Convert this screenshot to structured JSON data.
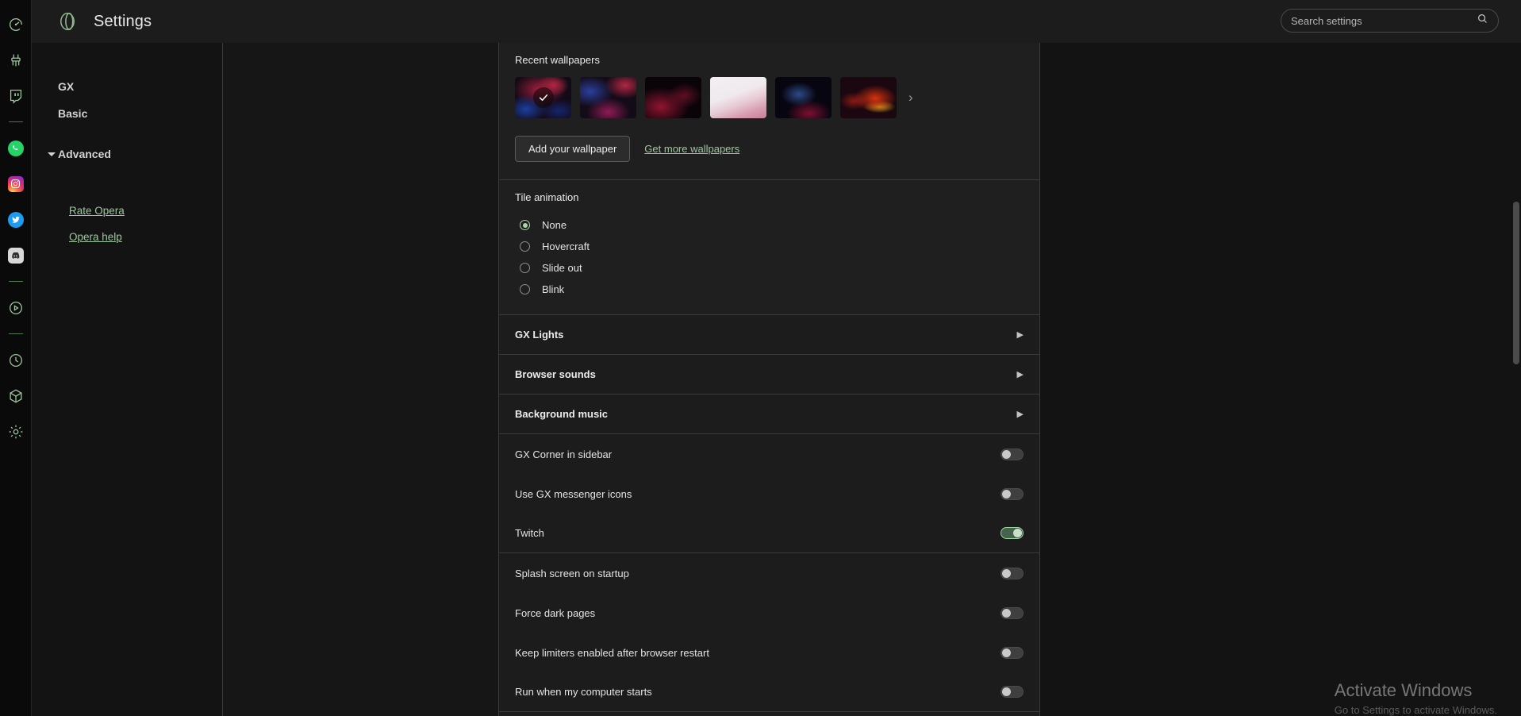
{
  "header": {
    "title": "Settings",
    "logo_icon": "opera-logo-icon",
    "search": {
      "placeholder": "Search settings",
      "value": "",
      "icon": "search-icon"
    }
  },
  "rail": {
    "items": [
      {
        "name": "speed-dial-icon",
        "kind": "outline"
      },
      {
        "name": "cleaner-broom-icon",
        "kind": "outline"
      },
      {
        "name": "twitch-icon",
        "kind": "outline"
      },
      {
        "name": "separator",
        "kind": "sep"
      },
      {
        "name": "whatsapp-icon",
        "kind": "color"
      },
      {
        "name": "instagram-icon",
        "kind": "color"
      },
      {
        "name": "twitter-icon",
        "kind": "color"
      },
      {
        "name": "discord-icon",
        "kind": "color"
      },
      {
        "name": "separator",
        "kind": "sep"
      },
      {
        "name": "player-icon",
        "kind": "outline"
      },
      {
        "name": "separator",
        "kind": "sep"
      },
      {
        "name": "history-clock-icon",
        "kind": "outline"
      },
      {
        "name": "extensions-cube-icon",
        "kind": "outline"
      },
      {
        "name": "settings-gear-icon",
        "kind": "outline"
      }
    ]
  },
  "nav": {
    "items": [
      {
        "label": "GX"
      },
      {
        "label": "Basic"
      },
      {
        "label": "Advanced"
      }
    ],
    "help_links": [
      {
        "label": "Rate Opera"
      },
      {
        "label": "Opera help"
      }
    ]
  },
  "wallpapers": {
    "title": "Recent wallpapers",
    "thumbs": [
      {
        "name": "wallpaper-thumb-1",
        "selected": true
      },
      {
        "name": "wallpaper-thumb-2",
        "selected": false
      },
      {
        "name": "wallpaper-thumb-3",
        "selected": false
      },
      {
        "name": "wallpaper-thumb-4",
        "selected": false
      },
      {
        "name": "wallpaper-thumb-5",
        "selected": false
      },
      {
        "name": "wallpaper-thumb-6",
        "selected": false
      }
    ],
    "next_arrow": "›",
    "add_button": "Add your wallpaper",
    "get_more_link": "Get more wallpapers"
  },
  "tile_animation": {
    "title": "Tile animation",
    "selected": "None",
    "options": [
      {
        "label": "None",
        "checked": true
      },
      {
        "label": "Hovercraft",
        "checked": false
      },
      {
        "label": "Slide out",
        "checked": false
      },
      {
        "label": "Blink",
        "checked": false
      }
    ]
  },
  "expandables": [
    {
      "label": "GX Lights",
      "chevron": "▶"
    },
    {
      "label": "Browser sounds",
      "chevron": "▶"
    },
    {
      "label": "Background music",
      "chevron": "▶"
    }
  ],
  "toggle_groups": [
    {
      "rows": [
        {
          "label": "GX Corner in sidebar",
          "on": false
        },
        {
          "label": "Use GX messenger icons",
          "on": false
        },
        {
          "label": "Twitch",
          "on": true
        }
      ]
    },
    {
      "rows": [
        {
          "label": "Splash screen on startup",
          "on": false
        },
        {
          "label": "Force dark pages",
          "on": false
        },
        {
          "label": "Keep limiters enabled after browser restart",
          "on": false
        },
        {
          "label": "Run when my computer starts",
          "on": false
        }
      ]
    }
  ],
  "watermark": {
    "title": "Activate Windows",
    "subtitle": "Go to Settings to activate Windows."
  },
  "colors": {
    "accent_green": "#9ec79e",
    "panel": "#1c1c1c",
    "card": "#1f1f1f",
    "background": "#131313",
    "rail": "#0a0a0a",
    "text": "#e4e4e4",
    "border": "#3a3a3a",
    "toggle_on": "#47624a"
  }
}
